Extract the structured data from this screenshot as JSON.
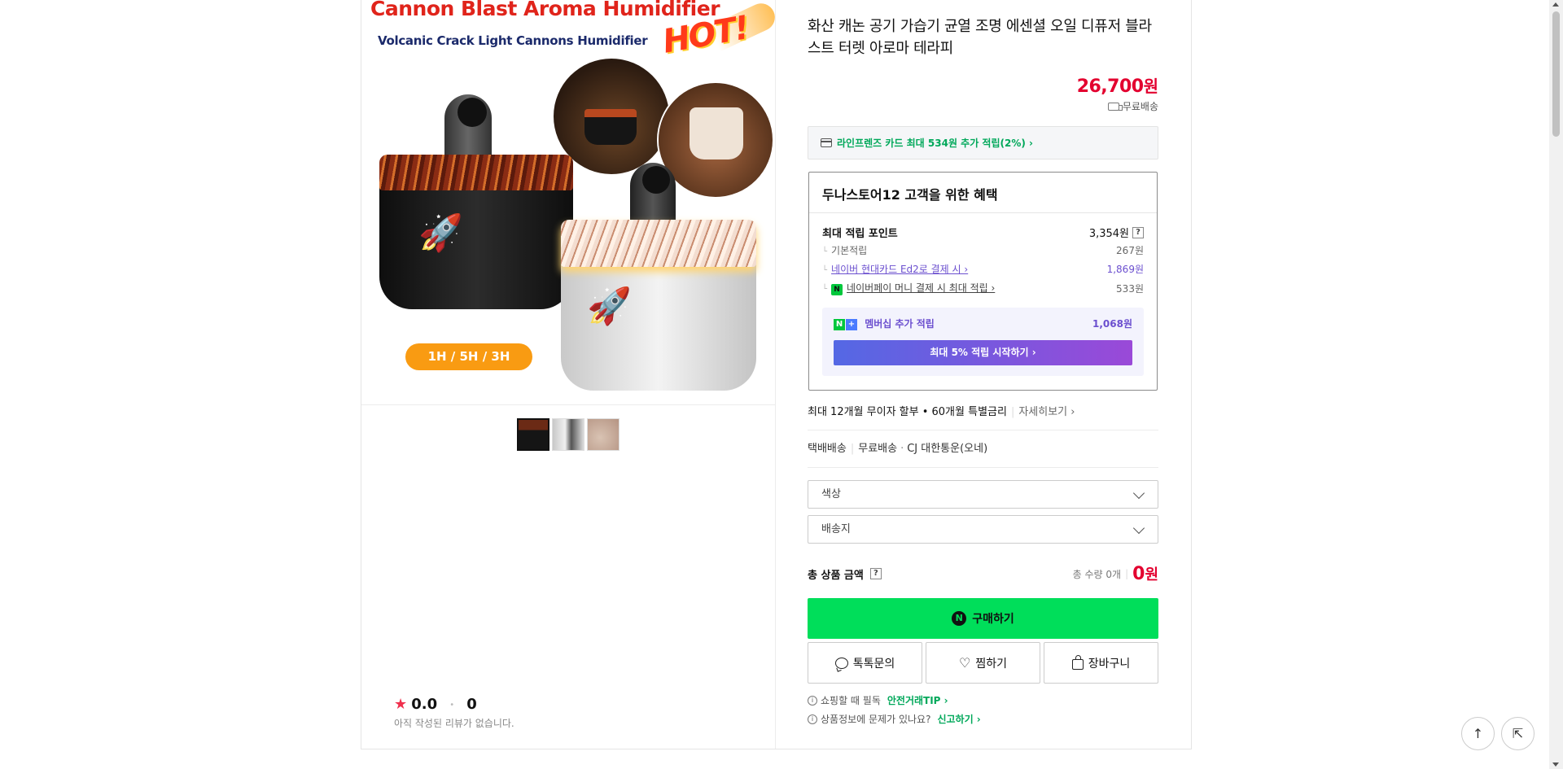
{
  "gallery": {
    "image": {
      "title": "Cannon Blast Aroma Humidifier",
      "subtitle": "Volcanic Crack Light Cannons Humidifier",
      "hot": "HOT!",
      "badge": "1H / 5H / 3H"
    },
    "thumbnails": 3,
    "selected_thumbnail": 1
  },
  "review": {
    "star": "★",
    "score": "0.0",
    "count": "0",
    "empty_text": "아직 작성된 리뷰가 없습니다."
  },
  "product": {
    "title": "화산 캐논 공기 가습기 균열 조명 에센셜 오일 디퓨저 블라스트 터렛 아로마 테라피",
    "price": "26,700",
    "price_unit": "원",
    "shipping": "무료배송"
  },
  "card_banner": {
    "text": "라인프렌즈 카드 최대 534원 추가 적립(2%) ›"
  },
  "benefits": {
    "title": "두나스토어12 고객을 위한 혜택",
    "max_points_label": "최대 적립 포인트",
    "max_points_value": "3,354원",
    "help": "?",
    "rows": [
      {
        "label": "기본적립",
        "value": "267원"
      },
      {
        "label": "네이버 현대카드 Ed2로 결제 시 ›",
        "value": "1,869원"
      },
      {
        "label": "네이버페이 머니 결제 시 최대 적립 ›",
        "value": "533원"
      }
    ],
    "npay_icon": "N",
    "membership": {
      "label": "멤버십 추가 적립",
      "value": "1,068원",
      "button": "최대 5% 적립 시작하기 ›"
    }
  },
  "installment": {
    "text": "최대 12개월 무이자 할부 • 60개월 특별금리",
    "more": "자세히보기 ›"
  },
  "delivery": {
    "type": "택배배송",
    "fee": "무료배송",
    "carrier": "CJ 대한통운(오네)"
  },
  "options": {
    "color_placeholder": "색상",
    "ship_placeholder": "배송지"
  },
  "total": {
    "label": "총 상품 금액",
    "help": "?",
    "qty": "총 수량 0개",
    "amount": "0",
    "unit": "원"
  },
  "actions": {
    "buy": "구매하기",
    "buy_icon": "N",
    "talk": "톡톡문의",
    "wish": "찜하기",
    "cart": "장바구니"
  },
  "notices": {
    "n1_text": "쇼핑할 때 필독",
    "n1_link": "안전거래TIP ›",
    "n2_text": "상품정보에 문제가 있나요?",
    "n2_link": "신고하기 ›"
  },
  "floating": {
    "up": "↑",
    "share": "⇱"
  },
  "colors": {
    "price_red": "#e3002f",
    "naver_green": "#00de5a",
    "point_purple": "#6b4fcf"
  }
}
